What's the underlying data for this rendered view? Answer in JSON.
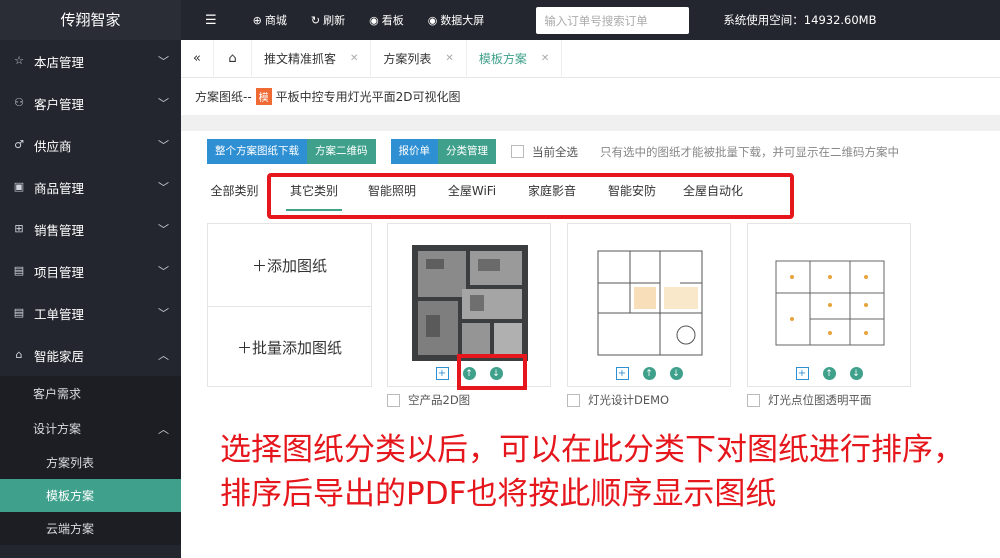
{
  "app": {
    "title": "传翔智家"
  },
  "sidebar": {
    "items": [
      {
        "label": "本店管理",
        "icon": "star-icon",
        "glyph": "☆"
      },
      {
        "label": "客户管理",
        "icon": "user-icon",
        "glyph": "⚇"
      },
      {
        "label": "供应商",
        "icon": "male-icon",
        "glyph": "♂"
      },
      {
        "label": "商品管理",
        "icon": "gift-icon",
        "glyph": "▣"
      },
      {
        "label": "销售管理",
        "icon": "cart-icon",
        "glyph": "⊞"
      },
      {
        "label": "项目管理",
        "icon": "clipboard-icon",
        "glyph": "▤"
      },
      {
        "label": "工单管理",
        "icon": "clipboard-icon",
        "glyph": "▤"
      },
      {
        "label": "智能家居",
        "icon": "home-icon",
        "glyph": "⌂"
      }
    ],
    "sub": {
      "customer_needs": "客户需求",
      "design_plans": "设计方案",
      "plan_list": "方案列表",
      "template_plans": "模板方案",
      "cloud_plans": "云端方案"
    }
  },
  "topbar": {
    "menu_glyph": "☰",
    "mall": "商城",
    "refresh": "刷新",
    "board": "看板",
    "bigscreen": "数据大屏",
    "search_placeholder": "输入订单号搜索订单",
    "storage": "系统使用空间：14932.60MB"
  },
  "tabs": [
    {
      "label": "推文精准抓客"
    },
    {
      "label": "方案列表"
    },
    {
      "label": "模板方案"
    }
  ],
  "breadcrumb": {
    "prefix": "方案图纸--",
    "tag": "模",
    "title": "平板中控专用灯光平面2D可视化图"
  },
  "toolbar": {
    "download_all": "整个方案图纸下载",
    "qr": "方案二维码",
    "quote": "报价单",
    "category_mgmt": "分类管理",
    "select_all": "当前全选",
    "hint": "只有选中的图纸才能被批量下载，并可显示在二维码方案中"
  },
  "categories": [
    "全部类别",
    "其它类别",
    "智能照明",
    "全屋WiFi",
    "家庭影音",
    "智能安防",
    "全屋自动化"
  ],
  "active_category": "其它类别",
  "add": {
    "single": "＋添加图纸",
    "batch": "＋批量添加图纸"
  },
  "cards": [
    {
      "caption": "空产品2D图"
    },
    {
      "caption": "灯光设计DEMO"
    },
    {
      "caption": "灯光点位图透明平面"
    }
  ],
  "annotation": "选择图纸分类以后，可以在此分类下对图纸进行排序，排序后导出的PDF也将按此顺序显示图纸",
  "colors": {
    "accent": "#3fa08b",
    "blue": "#2e8fd3",
    "red": "#e5161c",
    "dark": "#23262e"
  }
}
